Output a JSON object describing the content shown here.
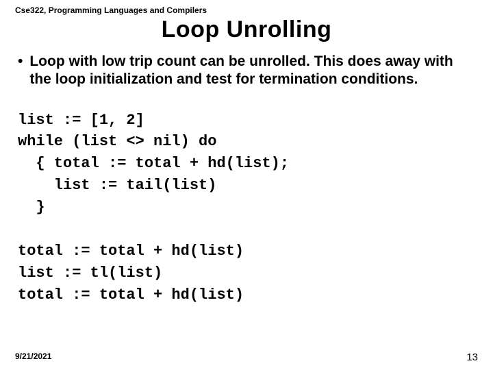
{
  "course_header": "Cse322, Programming Languages and Compilers",
  "title": "Loop Unrolling",
  "bullet": "Loop with low trip count can be unrolled. This does away with the loop initialization and test for termination conditions.",
  "code_before": "list := [1, 2]\nwhile (list <> nil) do\n  { total := total + hd(list);\n    list := tail(list)\n  }",
  "code_after": "total := total + hd(list)\nlist := tl(list)\ntotal := total + hd(list)",
  "footer_date": "9/21/2021",
  "footer_page": "13"
}
